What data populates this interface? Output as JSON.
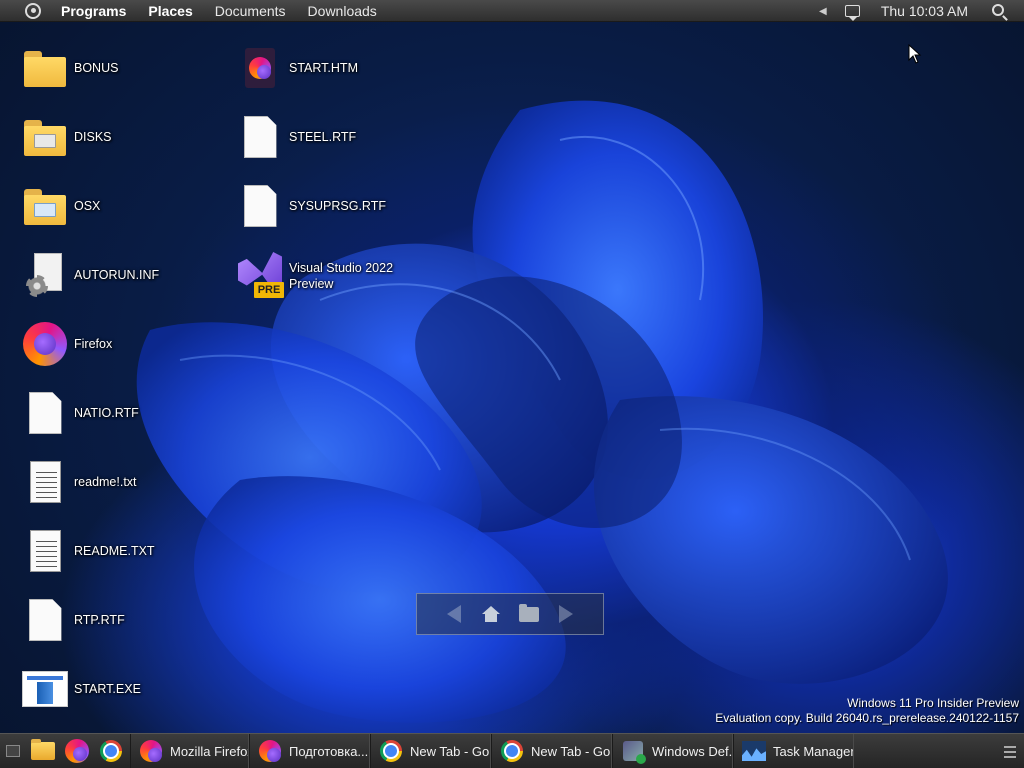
{
  "top_panel": {
    "menus": [
      "Programs",
      "Places",
      "Documents",
      "Downloads"
    ],
    "clock": "Thu 10:03 AM"
  },
  "desktop": {
    "icons_col1": [
      {
        "label": "BONUS",
        "icon": "folder-icon"
      },
      {
        "label": "DISKS",
        "icon": "folder-icon"
      },
      {
        "label": "OSX",
        "icon": "folder-icon"
      },
      {
        "label": "AUTORUN.INF",
        "icon": "settings-file-icon"
      },
      {
        "label": "Firefox",
        "icon": "firefox-icon"
      },
      {
        "label": "NATIO.RTF",
        "icon": "document-icon"
      },
      {
        "label": "readme!.txt",
        "icon": "text-file-icon"
      },
      {
        "label": "README.TXT",
        "icon": "text-file-icon"
      },
      {
        "label": "RTP.RTF",
        "icon": "document-icon"
      },
      {
        "label": "START.EXE",
        "icon": "application-icon"
      }
    ],
    "icons_col2": [
      {
        "label": "START.HTM",
        "icon": "firefox-html-icon"
      },
      {
        "label": "STEEL.RTF",
        "icon": "document-icon"
      },
      {
        "label": "SYSUPRSG.RTF",
        "icon": "document-icon"
      },
      {
        "label": "Visual Studio 2022\nPreview",
        "icon": "visual-studio-icon"
      }
    ],
    "vs_badge": "PRE"
  },
  "watermark": {
    "line1": "Windows 11 Pro Insider Preview",
    "line2": "Evaluation copy. Build 26040.rs_prerelease.240122-1157"
  },
  "taskbar": {
    "tasks": [
      {
        "label": "Mozilla Firefox",
        "icon": "firefox-icon"
      },
      {
        "label": "Подготовка...",
        "icon": "firefox-icon"
      },
      {
        "label": "New Tab - Go...",
        "icon": "chrome-icon"
      },
      {
        "label": "New Tab - Go...",
        "icon": "chrome-icon"
      },
      {
        "label": "Windows Def...",
        "icon": "defender-icon"
      },
      {
        "label": "Task Manager",
        "icon": "task-manager-icon"
      }
    ]
  },
  "colors": {
    "panel": "#2e2e2e",
    "wallpaper_blue": "#1a4dff",
    "folder_yellow": "#ffd966"
  }
}
